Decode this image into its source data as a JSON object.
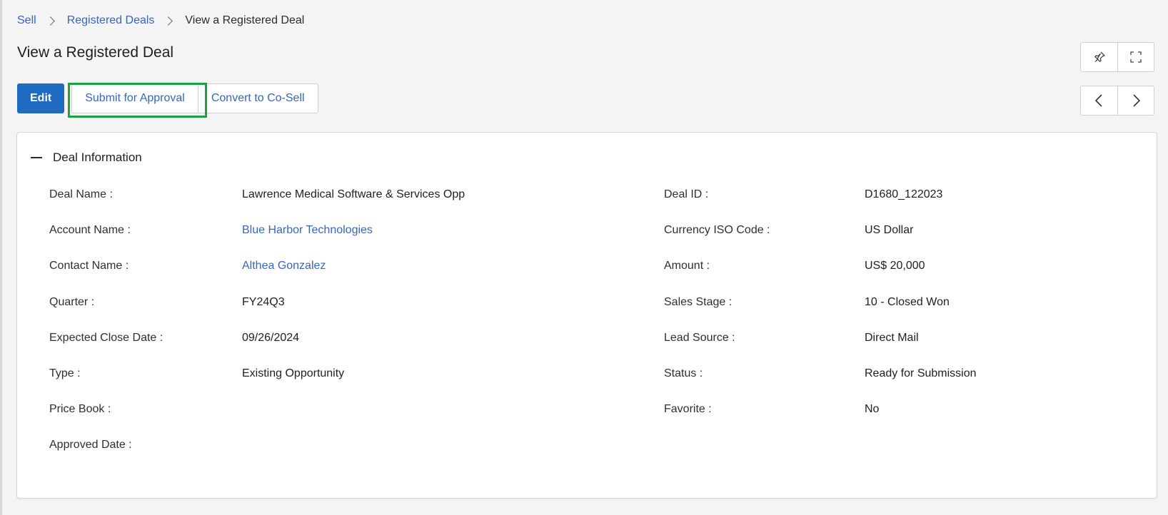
{
  "breadcrumb": {
    "items": [
      "Sell",
      "Registered Deals"
    ],
    "current": "View a Registered Deal"
  },
  "page_title": "View a Registered Deal",
  "actions": {
    "edit": "Edit",
    "submit": "Submit for Approval",
    "convert": "Convert to Co-Sell"
  },
  "section": {
    "title": "Deal Information"
  },
  "fields": {
    "left": [
      {
        "label": "Deal Name :",
        "value": "Lawrence Medical Software & Services Opp"
      },
      {
        "label": "Account Name :",
        "value": "Blue Harbor Technologies"
      },
      {
        "label": "Contact Name :",
        "value": "Althea Gonzalez"
      },
      {
        "label": "Quarter :",
        "value": "FY24Q3"
      },
      {
        "label": "Expected Close Date :",
        "value": "09/26/2024"
      },
      {
        "label": "Type :",
        "value": "Existing Opportunity"
      },
      {
        "label": "Price Book :",
        "value": ""
      },
      {
        "label": "Approved Date :",
        "value": ""
      }
    ],
    "right": [
      {
        "label": "Deal ID :",
        "value": "D1680_122023"
      },
      {
        "label": "Currency ISO Code :",
        "value": "US Dollar"
      },
      {
        "label": "Amount :",
        "value": "US$ 20,000"
      },
      {
        "label": "Sales Stage :",
        "value": "10 - Closed Won"
      },
      {
        "label": "Lead Source :",
        "value": "Direct Mail"
      },
      {
        "label": "Status :",
        "value": "Ready for Submission"
      },
      {
        "label": "Favorite :",
        "value": "No"
      }
    ]
  },
  "icons": {
    "pin": "pin-icon",
    "fullscreen": "fullscreen-icon",
    "prev": "chevron-left-icon",
    "next": "chevron-right-icon"
  },
  "colors": {
    "primary": "#1f6bc1",
    "link": "#3866bd",
    "highlight": "#1fa045"
  }
}
